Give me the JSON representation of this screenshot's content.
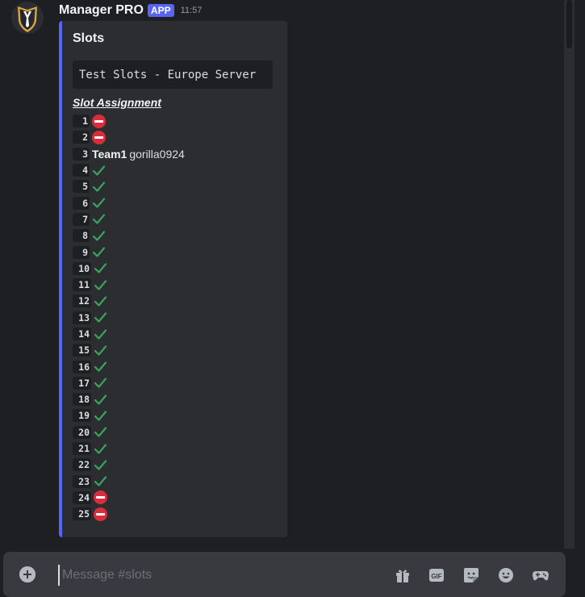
{
  "message": {
    "author": "Manager PRO",
    "badge": "APP",
    "time": "11:57"
  },
  "embed": {
    "title": "Slots",
    "code_text": "Test Slots - Europe Server",
    "section_heading": "Slot Assignment",
    "slots": [
      {
        "num": "1",
        "status": "closed"
      },
      {
        "num": "2",
        "status": "closed"
      },
      {
        "num": "3",
        "status": "assigned",
        "team": "Team1",
        "player": "gorilla0924"
      },
      {
        "num": "4",
        "status": "open"
      },
      {
        "num": "5",
        "status": "open"
      },
      {
        "num": "6",
        "status": "open"
      },
      {
        "num": "7",
        "status": "open"
      },
      {
        "num": "8",
        "status": "open"
      },
      {
        "num": "9",
        "status": "open"
      },
      {
        "num": "10",
        "status": "open"
      },
      {
        "num": "11",
        "status": "open"
      },
      {
        "num": "12",
        "status": "open"
      },
      {
        "num": "13",
        "status": "open"
      },
      {
        "num": "14",
        "status": "open"
      },
      {
        "num": "15",
        "status": "open"
      },
      {
        "num": "16",
        "status": "open"
      },
      {
        "num": "17",
        "status": "open"
      },
      {
        "num": "18",
        "status": "open"
      },
      {
        "num": "19",
        "status": "open"
      },
      {
        "num": "20",
        "status": "open"
      },
      {
        "num": "21",
        "status": "open"
      },
      {
        "num": "22",
        "status": "open"
      },
      {
        "num": "23",
        "status": "open"
      },
      {
        "num": "24",
        "status": "closed"
      },
      {
        "num": "25",
        "status": "closed"
      }
    ]
  },
  "composer": {
    "placeholder": "Message #slots"
  },
  "icons": {
    "add": "plus-circle-icon",
    "gift": "gift-icon",
    "gif": "gif-icon",
    "sticker": "sticker-icon",
    "emoji": "emoji-icon",
    "apps": "gamepad-icon"
  },
  "colors": {
    "accent": "#5865f2",
    "check": "#3ba55d",
    "no_entry": "#d82e3c"
  }
}
